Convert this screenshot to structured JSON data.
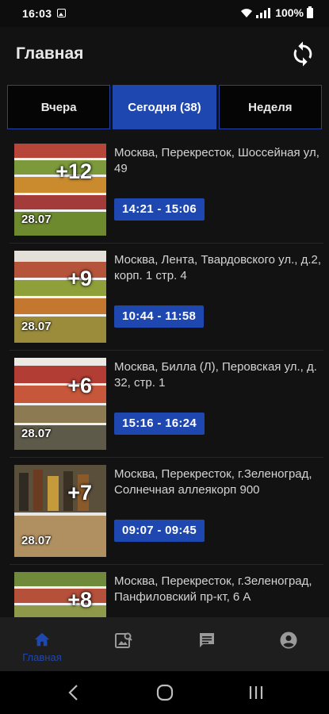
{
  "status_bar": {
    "time": "16:03",
    "battery_text": "100%",
    "icons": [
      "image-icon",
      "wifi-icon",
      "signal-icon",
      "battery-icon"
    ]
  },
  "header": {
    "title": "Главная",
    "refresh_icon": "refresh-icon"
  },
  "tabs": [
    {
      "label": "Вчера",
      "active": false
    },
    {
      "label": "Сегодня (38)",
      "active": true
    },
    {
      "label": "Неделя",
      "active": false
    }
  ],
  "items": [
    {
      "count": "+12",
      "date": "28.07",
      "address": "Москва, Перекресток, Шоссейная ул, 49",
      "time": "14:21 - 15:06"
    },
    {
      "count": "+9",
      "date": "28.07",
      "address": "Москва, Лента, Твардовского ул., д.2, корп. 1 стр. 4",
      "time": "10:44 - 11:58"
    },
    {
      "count": "+6",
      "date": "28.07",
      "address": "Москва, Билла (Л), Перовская ул., д. 32, стр. 1",
      "time": "15:16 - 16:24"
    },
    {
      "count": "+7",
      "date": "28.07",
      "address": "Москва, Перекресток, г.Зеленоград, Солнечная аллеякорп 900",
      "time": "09:07 - 09:45"
    },
    {
      "count": "+8",
      "date": "",
      "address": "Москва, Перекресток, г.Зеленоград, Панфиловский пр-кт, 6 А",
      "time": ""
    }
  ],
  "bottom_nav": [
    {
      "label": "Главная",
      "icon": "home-icon",
      "active": true
    },
    {
      "label": "",
      "icon": "photo-search-icon",
      "active": false
    },
    {
      "label": "",
      "icon": "chat-icon",
      "active": false
    },
    {
      "label": "",
      "icon": "account-icon",
      "active": false
    }
  ],
  "system_nav": [
    "back-icon",
    "home-circle-icon",
    "recents-icon"
  ],
  "colors": {
    "accent": "#1f47b0",
    "background": "#121212",
    "nav_background": "#1e1e1e"
  }
}
